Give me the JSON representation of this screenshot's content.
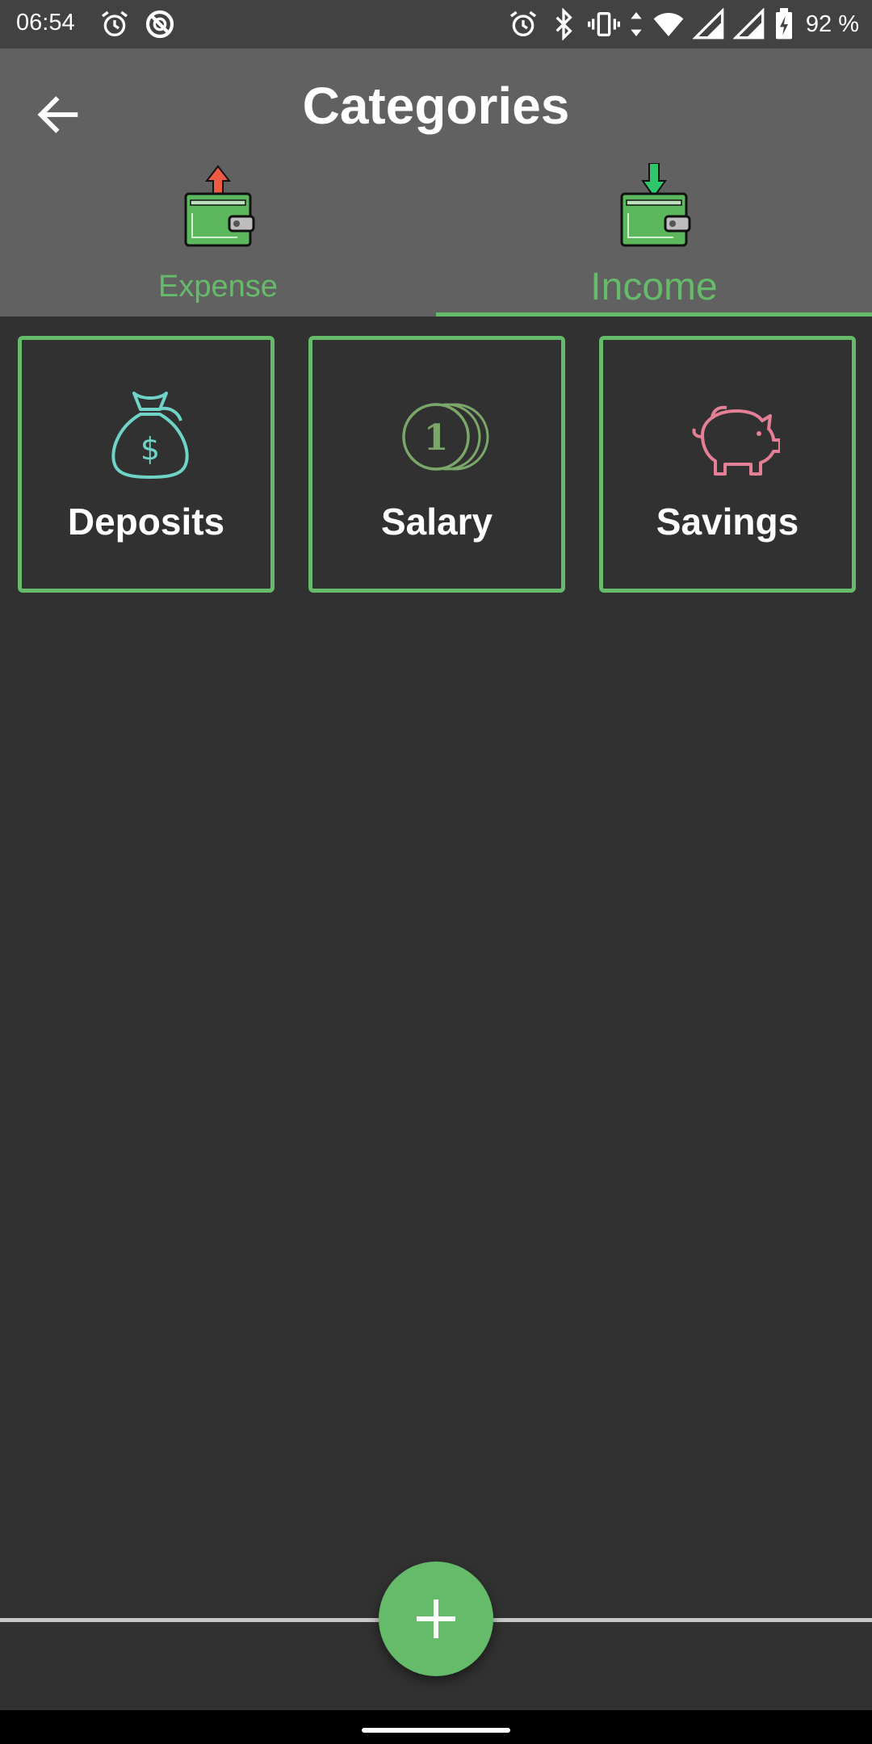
{
  "status_bar": {
    "time": "06:54",
    "battery": "92 %",
    "left_icons": [
      "alarm-icon",
      "do-not-disturb-icon"
    ],
    "right_icons": [
      "alarm-icon",
      "bluetooth-icon",
      "vibrate-icon",
      "data-arrows-icon",
      "wifi-icon",
      "signal-icon",
      "signal-icon",
      "battery-charging-icon"
    ]
  },
  "app_bar": {
    "title": "Categories",
    "back_icon": "arrow-back-icon"
  },
  "tabs": [
    {
      "label": "Expense",
      "icon": "wallet-expense-icon",
      "selected": false
    },
    {
      "label": "Income",
      "icon": "wallet-income-icon",
      "selected": true
    }
  ],
  "categories": [
    {
      "label": "Deposits",
      "icon": "money-bag-icon",
      "icon_color": "#6fd3c8"
    },
    {
      "label": "Salary",
      "icon": "coins-icon",
      "icon_color": "#7ba86a"
    },
    {
      "label": "Savings",
      "icon": "piggy-bank-icon",
      "icon_color": "#e57f95"
    }
  ],
  "fab": {
    "icon": "plus-icon"
  },
  "colors": {
    "accent": "#66bb6a",
    "background": "#313131",
    "app_bar": "#616161",
    "status_bar": "#424242"
  }
}
